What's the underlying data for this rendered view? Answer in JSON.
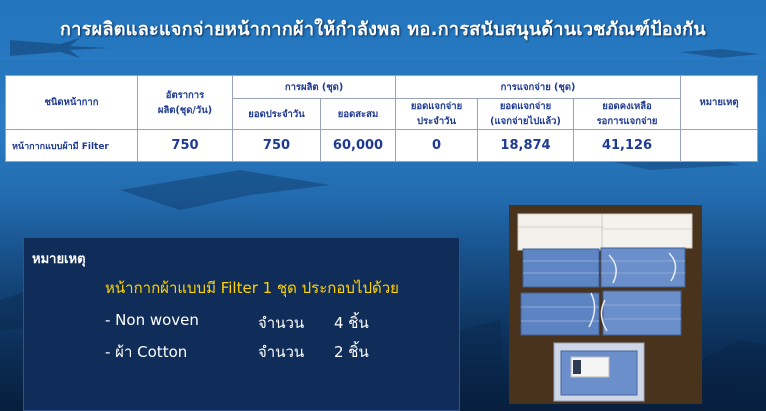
{
  "title": "การผลิตและแจกจ่ายหน้ากากผ้าให้กำลังพล ทอ.การสนับสนุนด้านเวชภัณฑ์ป้องกัน",
  "table": {
    "headers": {
      "mask_type": "ชนิดหน้ากาก",
      "prod_rate_line1": "อัตราการ",
      "prod_rate_line2": "ผลิต(ชุด/วัน)",
      "production_group": "การผลิต (ชุด)",
      "daily_output": "ยอดประจำวัน",
      "cumulative": "ยอดสะสม",
      "distribution_group": "การแจกจ่าย (ชุด)",
      "daily_dist_line1": "ยอดแจกจ่าย",
      "daily_dist_line2": "ประจำวัน",
      "total_dist_line1": "ยอดแจกจ่าย",
      "total_dist_line2": "(แจกจ่ายไปแล้ว)",
      "remaining_line1": "ยอดคงเหลือ",
      "remaining_line2": "รอการแจกจ่าย",
      "remarks": "หมายเหตุ"
    },
    "row": {
      "name": "หน้ากากแบบผ้ามี Filter",
      "rate": "750",
      "daily_output": "750",
      "cumulative": "60,000",
      "daily_dist": "0",
      "total_dist": "18,874",
      "remaining": "41,126",
      "remarks": ""
    }
  },
  "note": {
    "title": "หมายเหตุ",
    "heading": "หน้ากากผ้าแบบมี Filter 1 ชุด ประกอบไปด้วย",
    "items": [
      {
        "name": "- Non woven",
        "qty_label": "จำนวน",
        "qty": "4 ชิ้น"
      },
      {
        "name": "- ผ้า Cotton",
        "qty_label": "จำนวน",
        "qty": "2 ชิ้น"
      }
    ]
  },
  "colors": {
    "header_text": "#1f3a93",
    "note_heading": "#ffd400",
    "note_bg": "#102d5a"
  }
}
